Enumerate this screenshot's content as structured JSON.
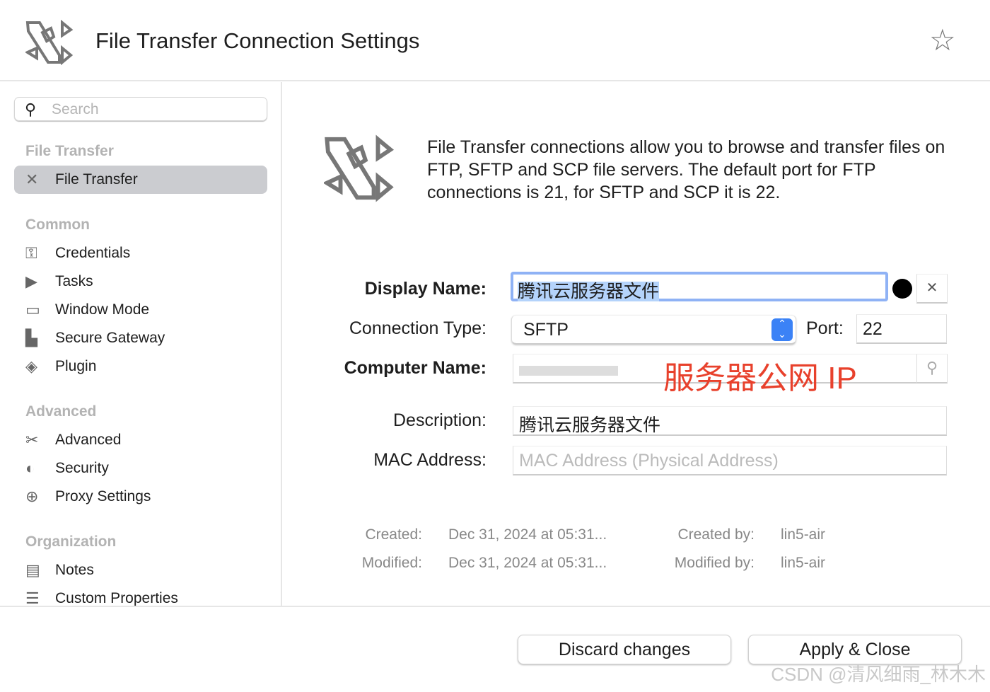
{
  "header": {
    "title": "File Transfer Connection Settings"
  },
  "sidebar": {
    "search_placeholder": "Search",
    "sections": [
      {
        "title": "File Transfer",
        "items": [
          {
            "label": "File Transfer",
            "icon": "file-transfer-icon",
            "selected": true
          }
        ]
      },
      {
        "title": "Common",
        "items": [
          {
            "label": "Credentials",
            "icon": "key-icon"
          },
          {
            "label": "Tasks",
            "icon": "tasks-icon"
          },
          {
            "label": "Window Mode",
            "icon": "window-icon"
          },
          {
            "label": "Secure Gateway",
            "icon": "gateway-icon"
          },
          {
            "label": "Plugin",
            "icon": "plugin-icon"
          }
        ]
      },
      {
        "title": "Advanced",
        "items": [
          {
            "label": "Advanced",
            "icon": "tools-icon"
          },
          {
            "label": "Security",
            "icon": "shield-icon"
          },
          {
            "label": "Proxy Settings",
            "icon": "globe-icon"
          }
        ]
      },
      {
        "title": "Organization",
        "items": [
          {
            "label": "Notes",
            "icon": "notes-icon"
          },
          {
            "label": "Custom Properties",
            "icon": "list-icon"
          }
        ]
      }
    ]
  },
  "main": {
    "description": "File Transfer connections allow you to browse and transfer files on FTP, SFTP and SCP file servers. The default port for FTP connections is 21, for SFTP and SCP it is 22.",
    "display_name_label": "Display Name:",
    "display_name": "腾讯云服务器文件",
    "connection_type_label": "Connection Type:",
    "connection_type": "SFTP",
    "port_label": "Port:",
    "port": "22",
    "computer_name_label": "Computer Name:",
    "computer_name_annotation": "服务器公网 IP",
    "description_label": "Description:",
    "description_value": "腾讯云服务器文件",
    "mac_label": "MAC Address:",
    "mac_placeholder": "MAC Address (Physical Address)",
    "created_label": "Created:",
    "created": "Dec 31, 2024 at 05:31...",
    "modified_label": "Modified:",
    "modified": "Dec 31, 2024 at 05:31...",
    "created_by_label": "Created by:",
    "created_by": "lin5-air",
    "modified_by_label": "Modified by:",
    "modified_by": "lin5-air"
  },
  "footer": {
    "discard": "Discard changes",
    "apply": "Apply & Close"
  },
  "watermark": "CSDN @清风细雨_林木木",
  "colors": {
    "accent": "#3b82f6",
    "annotation": "#e8412c",
    "selection": "#b4d3fb"
  }
}
